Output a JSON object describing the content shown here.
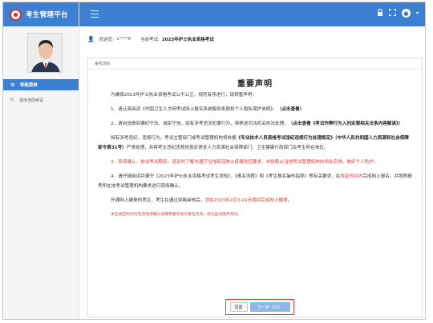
{
  "brand": {
    "title": "考生管理平台"
  },
  "sidebar": {
    "nav_header": "导航菜单",
    "items": [
      {
        "label": "退出当前考试"
      }
    ]
  },
  "infobar": {
    "welcome_label": "欢迎您:",
    "username": "1****8",
    "exam_label": "当前考试:",
    "exam_name": "2023年护士执业资格考试"
  },
  "panel": {
    "header": "报考流程",
    "title": "重要声明",
    "p0": "为确保2023年护士执业资格考试公平公正、规范有序进行，现郑重声明：",
    "p1_a": "1．请认真阅读《中国卫生人才网考试网上报名系统服务条款和个人隐私保护说明》。",
    "p1_b": "（点击查看）",
    "p2_a": "2．请自觉做到遵纪守法、诚实守信，如有涉考违法犯罪行为，将移送司法机关依法处理。",
    "p2_b": "（点击查看《考试作弊行为入刑定罪相关法条内容解读》）",
    "p3_a": "如有涉考违纪、违规行为，考试主管部门或考试管理机构将依据",
    "p3_b": "《专业技术人员资格考试违纪违规行为处理规定》（中华人民共和国人力资源和社会保障部令第31号）",
    "p3_c": "严肃处理，并将考生违纪违规信息反馈至人力资源社会保障部门、卫生健康行政部门及考生所在单位。",
    "p4": "3．现场确认、参加考试期间，请及时了解并遵守当地新冠肺炎疫情防控要求，自觉服从当地考试管理机构的相关安排，做好个人防护。",
    "p5_a": "4．请仔细阅读并遵守《2023年护士执业资格考试考生须知》、《报名流程》和《考生报名操作指导》等有关要求，在",
    "p5_b": "规定时间内",
    "p5_c": "完成网上报名，并按照报考所在地考试管理机构要求进行现场确认。",
    "p6_a": "开通网上缴费的考区，考生在通过资格审核后，",
    "p6_b": "须在2023年2月3-14日期间完成网上缴费",
    "p6_c": "。",
    "p7": "未在规定时间内完成现场确认或缴费者均视为报名无效，视为自动放弃考试。",
    "agree_button": "同意",
    "next_button": "下一步（19）"
  },
  "colors": {
    "primary": "#3d7fd0",
    "warning": "#e53935",
    "next_button": "#8fb6e5"
  },
  "icons": {
    "menu": "menu-icon",
    "lock": "lock-icon",
    "fullscreen": "fullscreen-icon",
    "user": "user-circle-icon",
    "chevron": "chevron-down-icon"
  }
}
